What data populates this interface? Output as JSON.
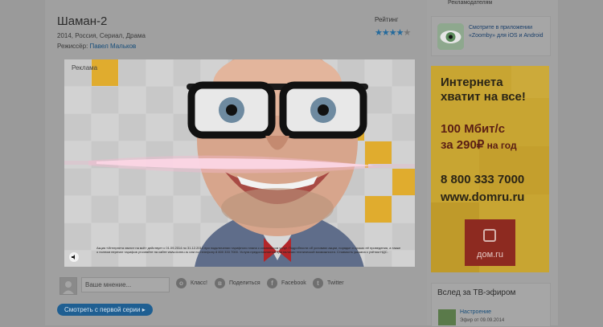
{
  "top_link": "Рекламодателям",
  "movie": {
    "title": "Шаман-2",
    "meta": "2014, Россия, Сериал, Драма",
    "director_label": "Режиссёр:",
    "director_name": "Павел Мальков",
    "rating_label": "Рейтинг",
    "rating": {
      "filled": 4,
      "total": 5
    }
  },
  "player": {
    "ad_label": "Реклама",
    "disclaimer": "Акция «Интернета хватит на всё» действует с 01.09.2014 по 31.12.2014 при подключении тарифного плана с комплексом услуг. Подробности об условиях акции, порядке и сроках её проведения, а также о полном перечне тарифов уточняйте на сайте www.domru.ru или по телефону 8 800 333 7000. Услуга предоставляется при наличии технической возможности. Стоимость указана с учётом НДС."
  },
  "comment": {
    "placeholder": "Ваше мнение..."
  },
  "share": [
    {
      "label": "Класс!",
      "glyph": "о"
    },
    {
      "label": "Поделиться",
      "glyph": "в"
    },
    {
      "label": "Facebook",
      "glyph": "f"
    },
    {
      "label": "Twitter",
      "glyph": "t"
    }
  ],
  "watch_button": "Смотреть с первой серии ▸",
  "app_promo": {
    "text": "Смотрите в приложении «Zoomby» для iOS и Android",
    "icon": "eye-app-icon"
  },
  "banner": {
    "headline_1": "Интернета",
    "headline_2": "хватит на все!",
    "offer_1": "100 Мбит/с",
    "offer_2_prefix": "за 290",
    "currency": "₽",
    "offer_2_suffix": " на год",
    "phone": "8 800 333 7000",
    "site": "www.domru.ru",
    "logo_text": "дом.ru"
  },
  "tv": {
    "title": "Вслед за ТВ-эфиром",
    "show_name": "Настроение",
    "show_date": "Эфир от 09.09.2014"
  }
}
